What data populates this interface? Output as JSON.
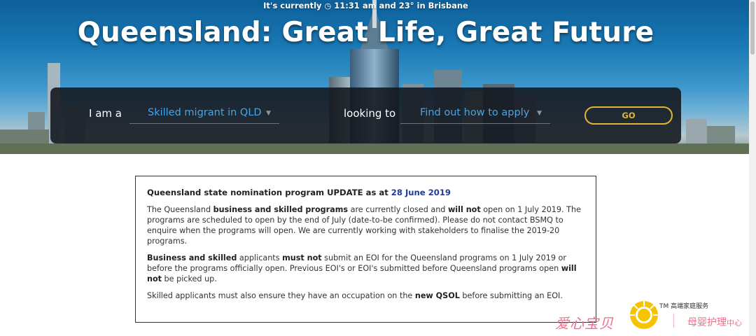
{
  "header": {
    "weather_prefix": "It's currently",
    "clock_icon": "clock-icon",
    "weather_text": "11:31 am and 23° in Brisbane",
    "title": "Queensland: Great Life, Great Future"
  },
  "finder": {
    "iam_label": "I am a",
    "who_value": "Skilled migrant in QLD",
    "looking_label": "looking to",
    "what_value": "Find out how to apply",
    "go_label": "GO"
  },
  "notice": {
    "heading_prefix": "Queensland state nomination program UPDATE as at",
    "heading_date": "28 June 2019",
    "p1": {
      "t1": "The Queensland ",
      "b1": "business and skilled programs",
      "t2": " are currently closed and ",
      "b2": "will not",
      "t3": " open on 1 July 2019. The programs are scheduled to open by the end of July (date-to-be confirmed). Please do not contact BSMQ to enquire when the programs will open. We are currently working with stakeholders to finalise the 2019-20 programs."
    },
    "p2": {
      "b1": "Business and skilled",
      "t1": " applicants ",
      "b2": "must not",
      "t2": " submit an EOI for the Queensland programs on 1 July 2019 or before the programs officially open. Previous EOI's or EOI's submitted before Queensland programs open ",
      "b3": "will not",
      "t3": " be picked up."
    },
    "p3": {
      "t1": "Skilled applicants must also ensure they have an occupation on the ",
      "b1": "new QSOL",
      "t2": " before submitting an EOI."
    }
  },
  "watermark": {
    "left_text": "爱心宝贝",
    "tm": "TM",
    "tagline": "高端家庭服务",
    "right_text": "母婴护理",
    "right_small": "中心"
  },
  "colors": {
    "accent_gold": "#e0b531",
    "select_blue": "#4aa3e3",
    "date_blue": "#1c3aa0",
    "watermark_pink": "#f16f8b"
  }
}
